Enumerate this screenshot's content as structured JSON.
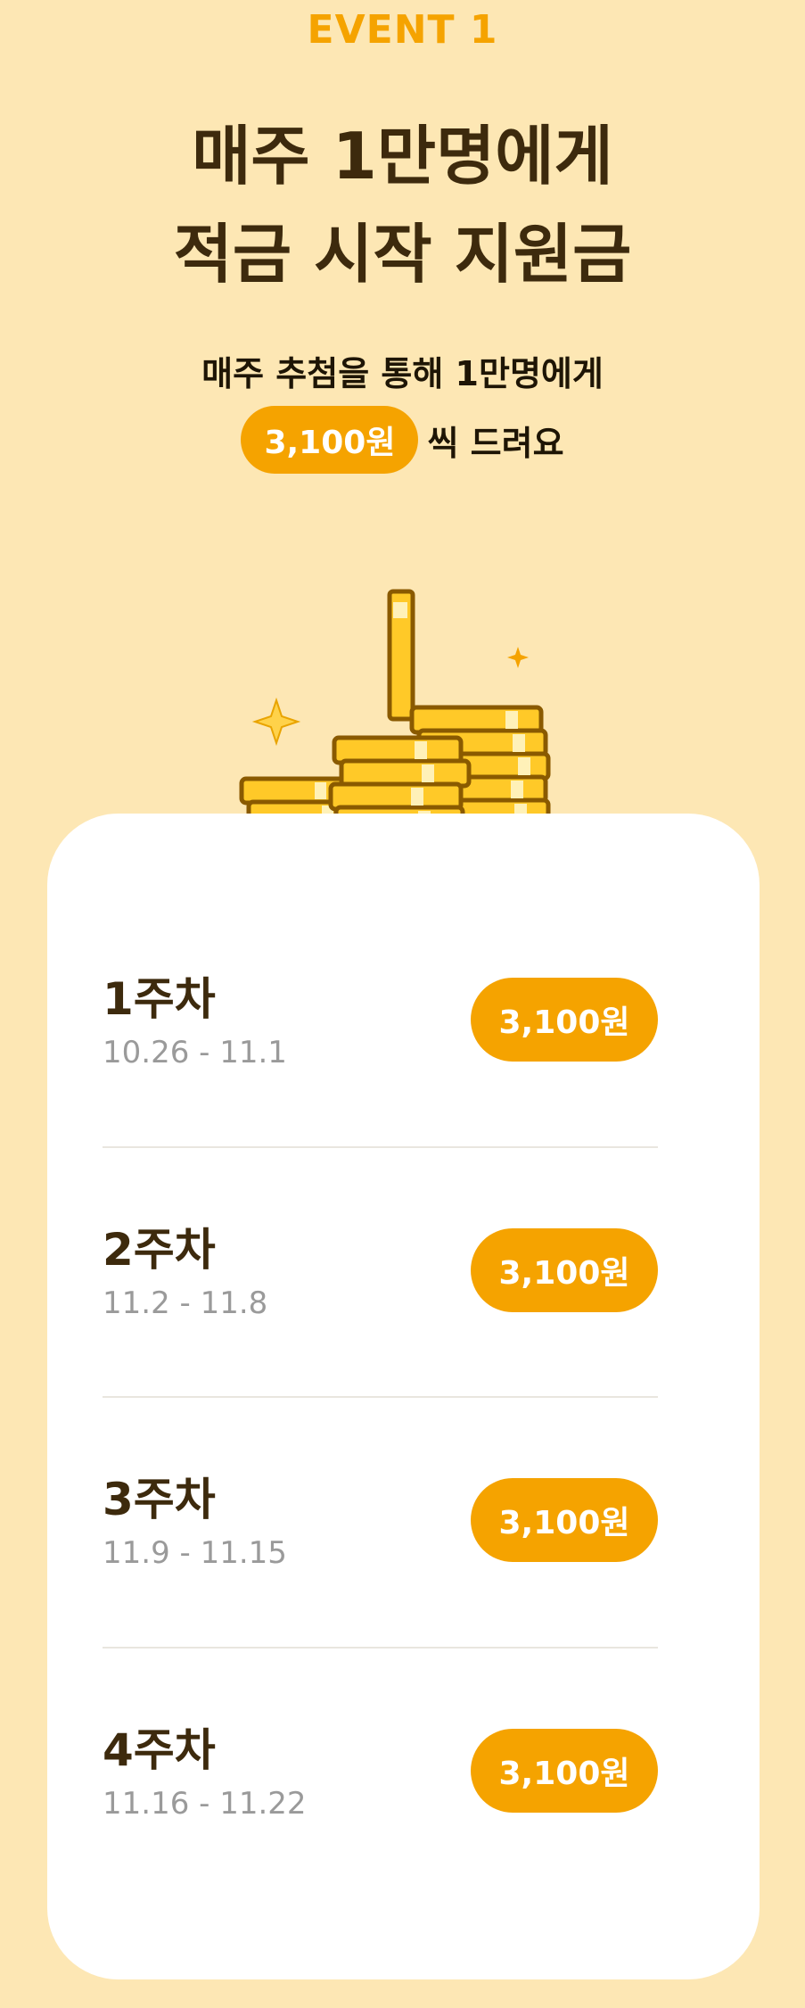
{
  "header": {
    "event_label": "EVENT 1",
    "headline_line1": "매주 1만명에게",
    "headline_line2": "적금 시작 지원금",
    "sub_line1": "매주 추첨을 통해 1만명에게",
    "sub_amount": "3,100원",
    "sub_suffix": "씩 드려요"
  },
  "illustration": {
    "icon": "coin-stack-icon"
  },
  "weeks": [
    {
      "title": "1주차",
      "dates": "10.26 - 11.1",
      "amount": "3,100원"
    },
    {
      "title": "2주차",
      "dates": "11.2 - 11.8",
      "amount": "3,100원"
    },
    {
      "title": "3주차",
      "dates": "11.9 - 11.15",
      "amount": "3,100원"
    },
    {
      "title": "4주차",
      "dates": "11.16 - 11.22",
      "amount": "3,100원"
    }
  ],
  "colors": {
    "background": "#FDE7B4",
    "accent": "#F5A300",
    "headline": "#3D2A0D",
    "muted": "#9A9A9A"
  }
}
